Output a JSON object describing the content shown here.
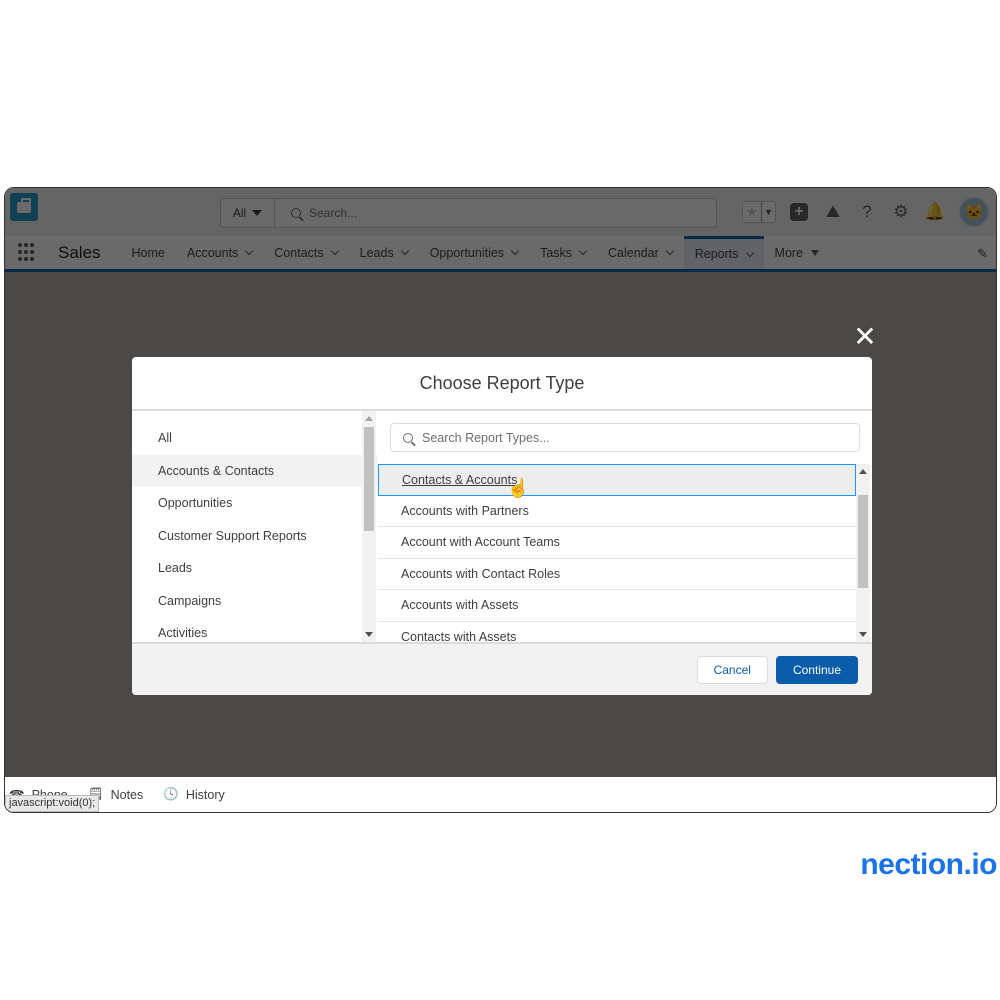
{
  "header": {
    "search_scope": "All",
    "search_placeholder": "Search..."
  },
  "nav": {
    "app_name": "Sales",
    "items": [
      {
        "label": "Home",
        "dropdown": false
      },
      {
        "label": "Accounts",
        "dropdown": true
      },
      {
        "label": "Contacts",
        "dropdown": true
      },
      {
        "label": "Leads",
        "dropdown": true
      },
      {
        "label": "Opportunities",
        "dropdown": true
      },
      {
        "label": "Tasks",
        "dropdown": true
      },
      {
        "label": "Calendar",
        "dropdown": true
      },
      {
        "label": "Reports",
        "dropdown": true,
        "active": true
      },
      {
        "label": "More",
        "dropdown": true
      }
    ]
  },
  "modal": {
    "title": "Choose Report Type",
    "close_icon": "close-icon",
    "categories": [
      "All",
      "Accounts & Contacts",
      "Opportunities",
      "Customer Support Reports",
      "Leads",
      "Campaigns",
      "Activities"
    ],
    "selected_category": "Accounts & Contacts",
    "search_placeholder": "Search Report Types...",
    "report_types": [
      "Contacts & Accounts",
      "Accounts with Partners",
      "Account with Account Teams",
      "Accounts with Contact Roles",
      "Accounts with Assets",
      "Contacts with Assets"
    ],
    "hovered_report_type": "Contacts & Accounts",
    "cancel_label": "Cancel",
    "continue_label": "Continue"
  },
  "utility_bar": {
    "items": [
      "Phone",
      "Notes",
      "History"
    ],
    "status_tooltip": "javascript:void(0);"
  },
  "watermark": "nection.io",
  "colors": {
    "brand": "#0b5cab",
    "watermark": "#1a73e8"
  }
}
